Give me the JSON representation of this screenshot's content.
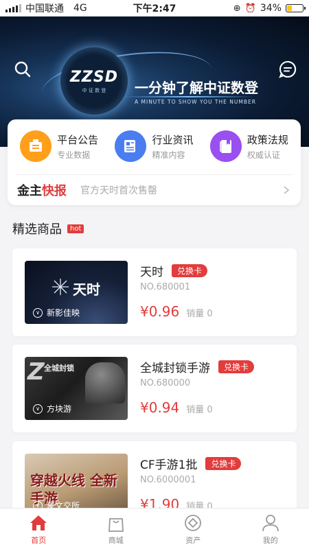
{
  "status_bar": {
    "carrier": "中国联通",
    "network": "4G",
    "time": "下午2:47",
    "battery": "34%",
    "battery_level": 0.34
  },
  "banner": {
    "logo_text": "ZZSD",
    "logo_sub": "中 证 数 登",
    "slogan": "一分钟了解中证数登",
    "slogan_en": "A MINUTE TO SHOW YOU THE NUMBER"
  },
  "quick_menu": [
    {
      "title": "平台公告",
      "subtitle": "专业数据",
      "icon": "announcement-icon",
      "color": "#ff9f1a"
    },
    {
      "title": "行业资讯",
      "subtitle": "精准内容",
      "icon": "news-icon",
      "color": "#4a7df0"
    },
    {
      "title": "政策法规",
      "subtitle": "权威认证",
      "icon": "policy-book-icon",
      "color": "#9a4ff0"
    }
  ],
  "news_ticker": {
    "logo_part1": "金主",
    "logo_part2": "快报",
    "text": "官方天时首次售罄"
  },
  "section": {
    "title": "精选商品",
    "badge": "hot"
  },
  "products": [
    {
      "name": "天时",
      "tag": "兑换卡",
      "code": "NO.680001",
      "price": "¥0.96",
      "sales": "销量 0",
      "thumb_label": "新影佳映",
      "thumb_brand": "天时"
    },
    {
      "name": "全城封锁手游",
      "tag": "兑换卡",
      "code": "NO.680000",
      "price": "¥0.94",
      "sales": "销量 0",
      "thumb_label": "方块游",
      "thumb_brand": "全城封锁"
    },
    {
      "name": "CF手游1批",
      "tag": "兑换卡",
      "code": "NO.6000001",
      "price": "¥1.90",
      "sales": "销量 0",
      "thumb_label": "蒙文交所",
      "thumb_brand": "穿越火线 全新手游"
    }
  ],
  "tabbar": [
    {
      "label": "首页",
      "icon": "home-icon",
      "active": true
    },
    {
      "label": "商城",
      "icon": "shopping-bag-icon",
      "active": false
    },
    {
      "label": "资产",
      "icon": "assets-icon",
      "active": false
    },
    {
      "label": "我的",
      "icon": "profile-icon",
      "active": false
    }
  ],
  "colors": {
    "accent": "#e23c3c",
    "banner_dark": "#0b1b33"
  }
}
